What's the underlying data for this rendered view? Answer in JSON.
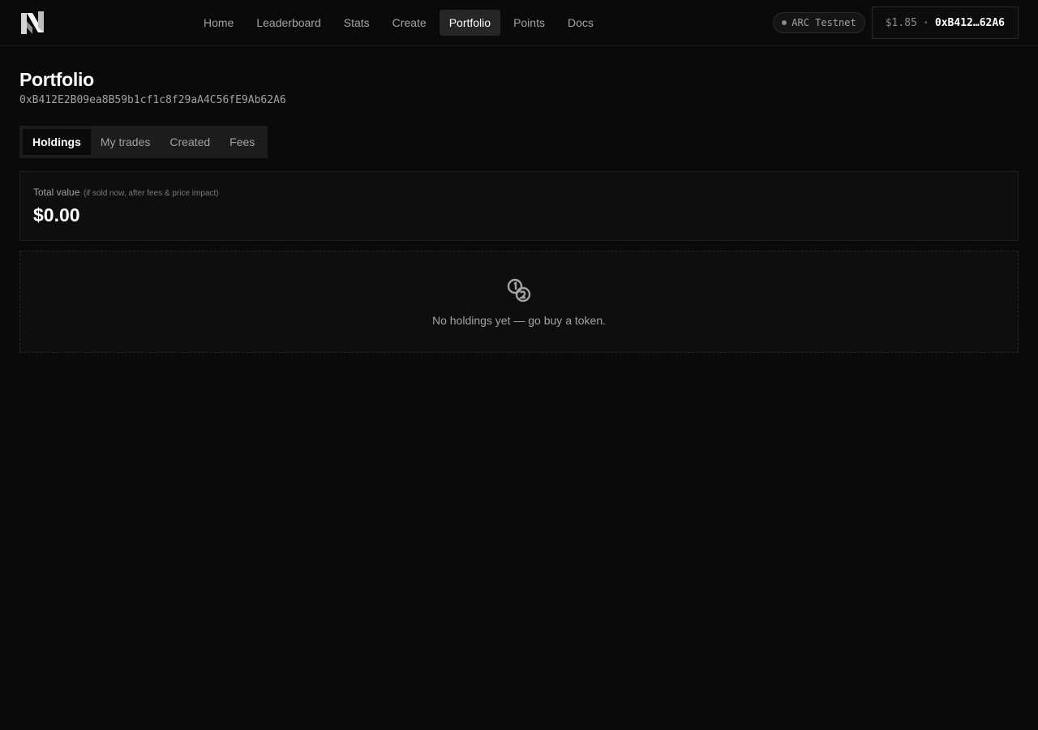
{
  "header": {
    "nav": [
      {
        "label": "Home",
        "active": false
      },
      {
        "label": "Leaderboard",
        "active": false
      },
      {
        "label": "Stats",
        "active": false
      },
      {
        "label": "Create",
        "active": false
      },
      {
        "label": "Portfolio",
        "active": true
      },
      {
        "label": "Points",
        "active": false
      },
      {
        "label": "Docs",
        "active": false
      }
    ],
    "network": "ARC Testnet",
    "wallet": {
      "balance": "$1.85",
      "separator": "•",
      "address": "0xB412…62A6"
    }
  },
  "page": {
    "title": "Portfolio",
    "address": "0xB412E2B09ea8B59b1cf1c8f29aA4C56fE9Ab62A6"
  },
  "tabs": [
    {
      "label": "Holdings",
      "active": true
    },
    {
      "label": "My trades",
      "active": false
    },
    {
      "label": "Created",
      "active": false
    },
    {
      "label": "Fees",
      "active": false
    }
  ],
  "total_value": {
    "label": "Total value",
    "note": "(if sold now, after fees & price impact)",
    "amount": "$0.00"
  },
  "empty_state": {
    "icon": "coins-icon",
    "text": "No holdings yet — go buy a token."
  },
  "colors": {
    "background": "#0a0a0a",
    "active_nav": "#262626",
    "text_muted": "#a3a3a3"
  }
}
